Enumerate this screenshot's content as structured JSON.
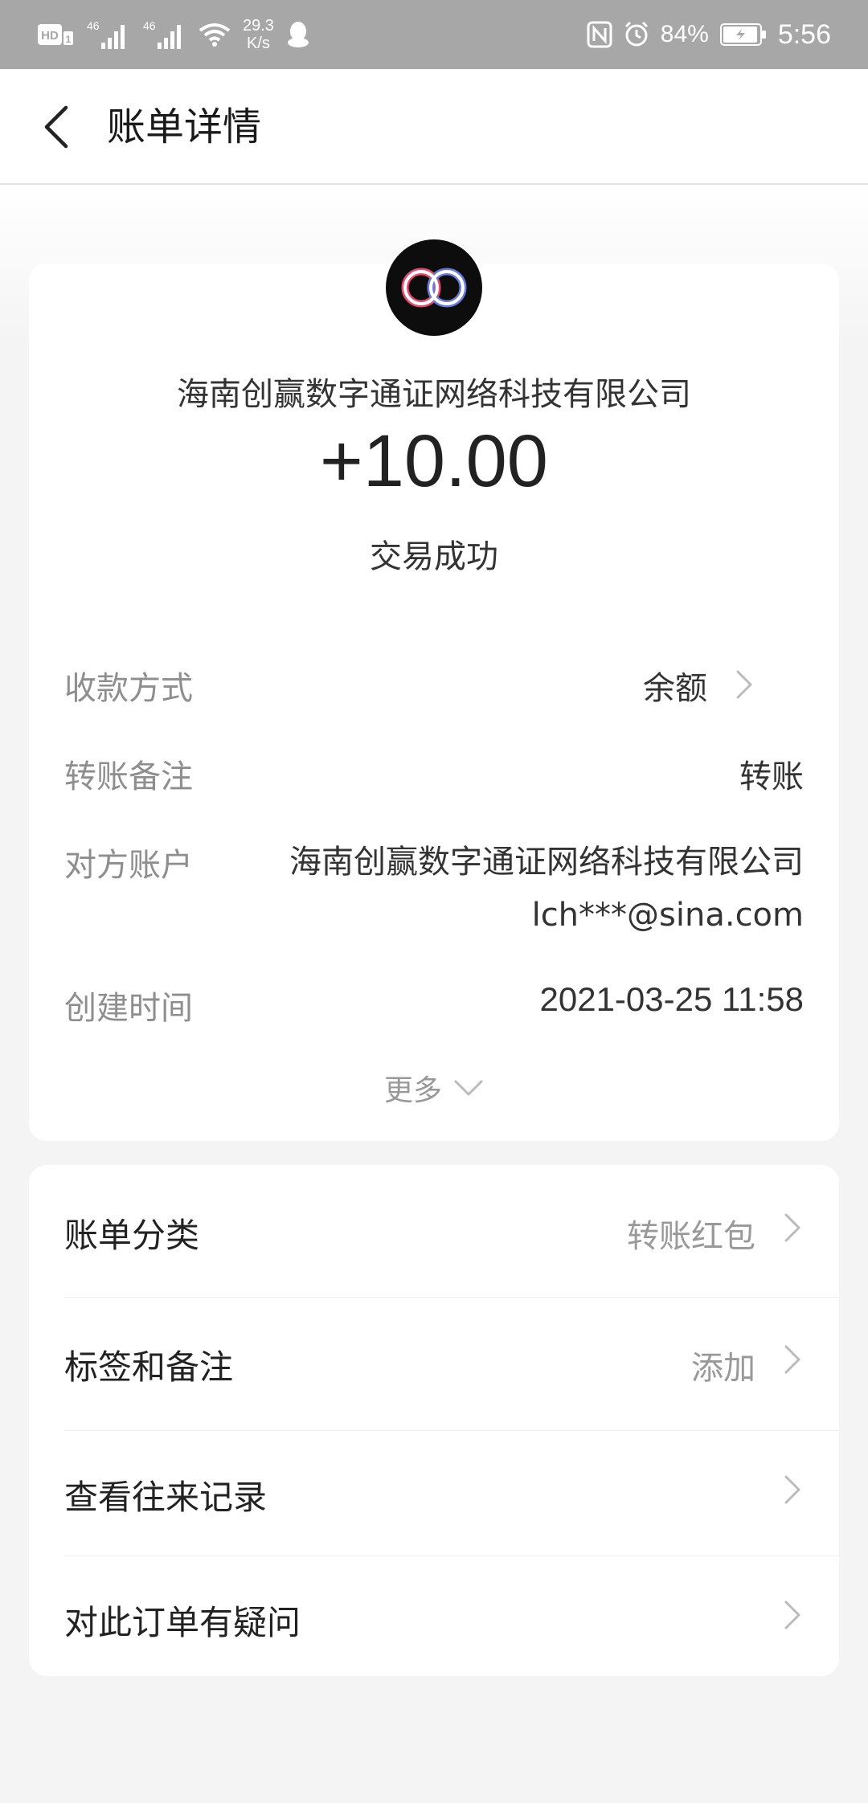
{
  "status_bar": {
    "hd": "HD",
    "sim1": "1",
    "net1": "46",
    "net2": "46",
    "speed_value": "29.3",
    "speed_unit": "K/s",
    "battery": "84%",
    "time": "5:56"
  },
  "header": {
    "title": "账单详情"
  },
  "summary": {
    "merchant_name": "海南创赢数字通证网络科技有限公司",
    "amount": "+10.00",
    "status": "交易成功"
  },
  "details": {
    "payment_method_label": "收款方式",
    "payment_method_value": "余额",
    "remark_label": "转账备注",
    "remark_value": "转账",
    "account_label": "对方账户",
    "account_value": "海南创赢数字通证网络科技有限公司 lch***@sina.com",
    "time_label": "创建时间",
    "time_value": "2021-03-25 11:58",
    "more_label": "更多"
  },
  "actions": {
    "category_label": "账单分类",
    "category_value": "转账红包",
    "tag_label": "标签和备注",
    "tag_value": "添加",
    "history_label": "查看往来记录",
    "question_label": "对此订单有疑问"
  },
  "colors": {
    "status_bar_bg": "#a7a7a7",
    "page_bg": "#f4f4f4",
    "card_bg": "#ffffff"
  }
}
